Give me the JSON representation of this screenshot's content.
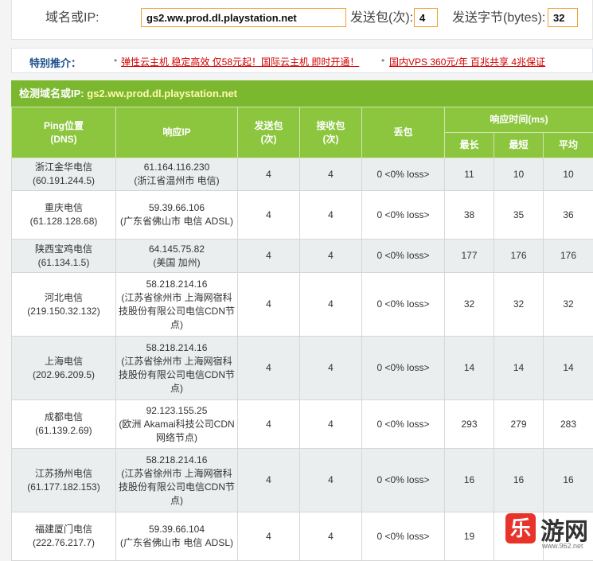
{
  "form": {
    "domain_label": "域名或IP:",
    "domain_value": "gs2.ww.prod.dl.playstation.net",
    "count_label": "发送包(次):",
    "count_value": "4",
    "bytes_label": "发送字节(bytes):",
    "bytes_value": "32"
  },
  "recommend": {
    "title": "特别推介：",
    "links": [
      "弹性云主机 稳定高效 仅58元起！国际云主机 即时开通！",
      "国内VPS 360元/年 百兆共享 4兆保证"
    ]
  },
  "results": {
    "domain_prefix": "检测域名或IP:",
    "domain": "gs2.ww.prod.dl.playstation.net",
    "headers": {
      "ping_pos": "Ping位置",
      "ping_dns": "(DNS)",
      "resp_ip": "响应IP",
      "sent": "发送包",
      "sent_unit": "(次)",
      "recv": "接收包",
      "recv_unit": "(次)",
      "loss": "丢包",
      "resp_time": "响应时间(ms)",
      "max": "最长",
      "min": "最短",
      "avg": "平均"
    },
    "rows": [
      {
        "loc": "浙江金华电信",
        "dns": "(60.191.244.5)",
        "ip": "61.164.116.230",
        "ip_loc": "(浙江省温州市 电信)",
        "sent": "4",
        "recv": "4",
        "loss": "0 <0% loss>",
        "max": "11",
        "min": "10",
        "avg": "10"
      },
      {
        "loc": "重庆电信",
        "dns": "(61.128.128.68)",
        "ip": "59.39.66.106",
        "ip_loc": "(广东省佛山市 电信 ADSL)",
        "sent": "4",
        "recv": "4",
        "loss": "0 <0% loss>",
        "max": "38",
        "min": "35",
        "avg": "36"
      },
      {
        "loc": "陕西宝鸡电信",
        "dns": "(61.134.1.5)",
        "ip": "64.145.75.82",
        "ip_loc": "(美国 加州)",
        "sent": "4",
        "recv": "4",
        "loss": "0 <0% loss>",
        "max": "177",
        "min": "176",
        "avg": "176"
      },
      {
        "loc": "河北电信",
        "dns": "(219.150.32.132)",
        "ip": "58.218.214.16",
        "ip_loc": "(江苏省徐州市 上海网宿科技股份有限公司电信CDN节点)",
        "sent": "4",
        "recv": "4",
        "loss": "0 <0% loss>",
        "max": "32",
        "min": "32",
        "avg": "32"
      },
      {
        "loc": "上海电信",
        "dns": "(202.96.209.5)",
        "ip": "58.218.214.16",
        "ip_loc": "(江苏省徐州市 上海网宿科技股份有限公司电信CDN节点)",
        "sent": "4",
        "recv": "4",
        "loss": "0 <0% loss>",
        "max": "14",
        "min": "14",
        "avg": "14"
      },
      {
        "loc": "成都电信",
        "dns": "(61.139.2.69)",
        "ip": "92.123.155.25",
        "ip_loc": "(欧洲 Akamai科技公司CDN网络节点)",
        "sent": "4",
        "recv": "4",
        "loss": "0 <0% loss>",
        "max": "293",
        "min": "279",
        "avg": "283"
      },
      {
        "loc": "江苏扬州电信",
        "dns": "(61.177.182.153)",
        "ip": "58.218.214.16",
        "ip_loc": "(江苏省徐州市 上海网宿科技股份有限公司电信CDN节点)",
        "sent": "4",
        "recv": "4",
        "loss": "0 <0% loss>",
        "max": "16",
        "min": "16",
        "avg": "16"
      },
      {
        "loc": "福建厦门电信",
        "dns": "(222.76.217.7)",
        "ip": "59.39.66.104",
        "ip_loc": "(广东省佛山市 电信 ADSL)",
        "sent": "4",
        "recv": "4",
        "loss": "0 <0% loss>",
        "max": "19",
        "min": "",
        "avg": ""
      }
    ]
  },
  "watermark": {
    "char": "乐",
    "text": "游网",
    "url": "www.962.net"
  },
  "colors": {
    "header_green": "#8cc63f",
    "domain_bar_green": "#7cb82f",
    "input_border": "#f0a030",
    "link_red": "#d20000",
    "alt_row": "#ebeeee"
  }
}
